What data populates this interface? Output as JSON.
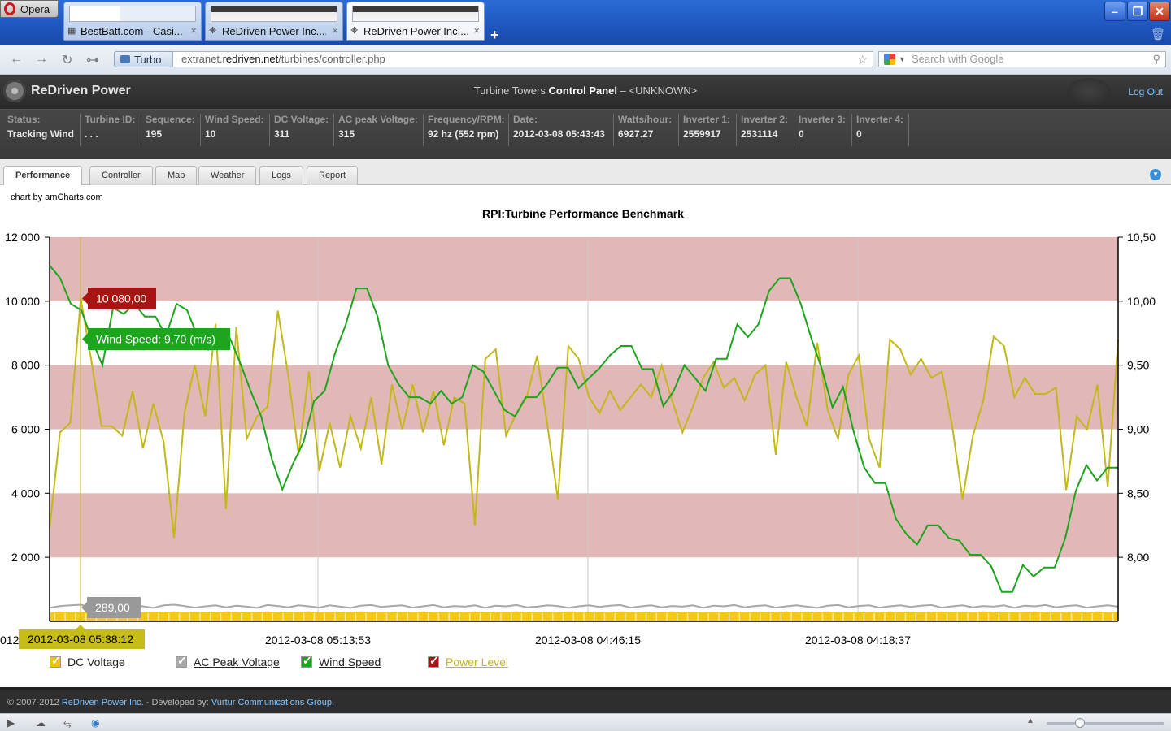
{
  "browser": {
    "menu_label": "Opera",
    "tabs": [
      {
        "label": "BestBatt.com - Casi...",
        "close": "×"
      },
      {
        "label": "ReDriven Power Inc....",
        "close": "×"
      },
      {
        "label": "ReDriven Power Inc....",
        "close": "×"
      }
    ],
    "new_tab": "+",
    "turbo_label": "Turbo",
    "url_prefix": "extranet.",
    "url_domain": "redriven.net",
    "url_path": "/turbines/controller.php",
    "search_placeholder": "Search with Google"
  },
  "app": {
    "logo_text": "ReDriven Power",
    "title_prefix": "Turbine Towers",
    "title_strong": "Control Panel",
    "title_suffix": "– <UNKNOWN>",
    "logout": "Log Out"
  },
  "status": [
    {
      "label": "Status:",
      "value": "Tracking Wind"
    },
    {
      "label": "Turbine ID:",
      "value": ". . ."
    },
    {
      "label": "Sequence:",
      "value": "195"
    },
    {
      "label": "Wind Speed:",
      "value": "10"
    },
    {
      "label": "DC Voltage:",
      "value": "311"
    },
    {
      "label": "AC peak Voltage:",
      "value": "315"
    },
    {
      "label": "Frequency/RPM:",
      "value": "92 hz (552 rpm)"
    },
    {
      "label": "Date:",
      "value": "2012-03-08 05:43:43"
    },
    {
      "label": "Watts/hour:",
      "value": "6927.27"
    },
    {
      "label": "Inverter 1:",
      "value": "2559917"
    },
    {
      "label": "Inverter 2:",
      "value": "2531114"
    },
    {
      "label": "Inverter 3:",
      "value": "0"
    },
    {
      "label": "Inverter 4:",
      "value": "0"
    }
  ],
  "nav_tabs": [
    "Performance",
    "Controller",
    "Map",
    "Weather",
    "Logs",
    "Report"
  ],
  "chart_credit": "chart by amCharts.com",
  "footer": {
    "copyright": "© 2007-2012",
    "company": "ReDriven Power Inc.",
    "dev_text": " - Developed by: ",
    "developer": "Vurtur Communications Group."
  },
  "chart_data": {
    "type": "line",
    "title": "RPI:Turbine Performance Benchmark",
    "left_axis": {
      "min": 0,
      "max": 12000,
      "ticks": [
        "12 000",
        "10 000",
        "8 000",
        "6 000",
        "4 000",
        "2 000"
      ]
    },
    "right_axis": {
      "min": 7.5,
      "max": 10.5,
      "ticks": [
        "10,50",
        "10,00",
        "9,50",
        "9,00",
        "8,50",
        "8,00"
      ]
    },
    "x_labels": [
      "2012-03-08 05:13:53",
      "2012-03-08 04:46:15",
      "2012-03-08 04:18:37"
    ],
    "x_label_clipped": "012",
    "bands": [
      [
        10000,
        12000
      ],
      [
        6000,
        8000
      ],
      [
        2000,
        4000
      ]
    ],
    "colors": {
      "power": "#c2b81a",
      "wind": "#1da51d",
      "dc": "#f2c200",
      "ac": "#a8a8a8",
      "band": "#e2b7b7",
      "balloon_red": "#a81313",
      "balloon_green": "#1ea51e",
      "balloon_gray": "#999999",
      "date_bg": "#c7bd17"
    },
    "cursor": {
      "date": "2012-03-08 05:38:12",
      "power_balloon": "10 080,00",
      "wind_balloon": "Wind Speed: 9,70 (m/s)",
      "voltage_balloon": "289,00"
    },
    "series": [
      {
        "name": "Power Level",
        "axis": "left",
        "values": [
          2900,
          5900,
          6200,
          10080,
          8200,
          6100,
          6100,
          5800,
          7200,
          5400,
          6800,
          5600,
          2600,
          6500,
          8000,
          6400,
          9300,
          3500,
          9200,
          5700,
          6400,
          6700,
          9700,
          7700,
          5200,
          7800,
          4700,
          6200,
          4800,
          6400,
          5400,
          7000,
          4900,
          7400,
          6000,
          7400,
          5900,
          7200,
          5500,
          7000,
          6800,
          3000,
          8200,
          8500,
          5800,
          6500,
          7000,
          8300,
          6100,
          3800,
          8600,
          8200,
          7000,
          6500,
          7200,
          6600,
          7000,
          7400,
          7000,
          8000,
          6900,
          5900,
          6700,
          7600,
          8100,
          7300,
          7600,
          6900,
          7700,
          8000,
          5200,
          8100,
          7000,
          6100,
          8700,
          6600,
          5700,
          7700,
          8300,
          5700,
          4800,
          8800,
          8500,
          7700,
          8200,
          7600,
          7800,
          6100,
          3800,
          5800,
          6900,
          8900,
          8600,
          7000,
          7600,
          7100,
          7100,
          7300,
          4100,
          6400,
          6000,
          7400,
          4200,
          8800
        ]
      },
      {
        "name": "Wind Speed",
        "axis": "right",
        "values": [
          10.28,
          10.18,
          9.98,
          9.93,
          9.7,
          9.5,
          9.95,
          9.9,
          9.98,
          9.88,
          9.88,
          9.73,
          9.98,
          9.93,
          9.72,
          9.62,
          9.68,
          9.72,
          9.52,
          9.3,
          9.1,
          8.77,
          8.53,
          8.73,
          8.9,
          9.22,
          9.3,
          9.6,
          9.82,
          10.1,
          10.1,
          9.88,
          9.5,
          9.35,
          9.25,
          9.25,
          9.2,
          9.3,
          9.2,
          9.25,
          9.5,
          9.45,
          9.3,
          9.15,
          9.1,
          9.25,
          9.25,
          9.35,
          9.48,
          9.48,
          9.32,
          9.4,
          9.48,
          9.58,
          9.65,
          9.65,
          9.47,
          9.47,
          9.18,
          9.3,
          9.5,
          9.4,
          9.3,
          9.55,
          9.55,
          9.82,
          9.72,
          9.82,
          10.08,
          10.18,
          10.18,
          9.98,
          9.71,
          9.47,
          9.17,
          9.33,
          8.98,
          8.7,
          8.58,
          8.58,
          8.3,
          8.18,
          8.1,
          8.25,
          8.25,
          8.15,
          8.13,
          8.02,
          8.02,
          7.93,
          7.73,
          7.73,
          7.94,
          7.85,
          7.92,
          7.92,
          8.15,
          8.52,
          8.72,
          8.6,
          8.7,
          8.7
        ]
      },
      {
        "name": "DC Voltage",
        "axis": "left",
        "values": [
          280,
          310,
          290,
          300,
          320,
          290,
          280,
          300,
          310,
          290,
          300,
          280,
          310,
          290,
          300,
          280,
          290,
          310,
          300,
          280,
          300,
          310,
          290,
          280,
          300,
          310,
          290,
          300,
          280,
          300,
          310,
          290,
          300,
          280,
          300,
          290,
          310,
          280,
          300,
          290,
          300,
          310,
          280,
          290,
          300,
          310,
          290,
          280,
          300,
          290,
          310,
          300,
          280,
          300,
          290,
          310,
          300,
          280,
          290,
          300,
          310,
          280,
          300,
          290,
          300,
          280,
          310,
          290,
          300,
          280,
          300,
          310,
          290,
          280,
          300,
          310,
          290,
          300,
          280,
          300,
          290,
          310,
          300,
          280,
          290,
          300,
          310,
          280,
          300,
          290,
          310,
          300,
          280,
          290,
          300,
          310,
          280,
          300,
          290,
          300,
          280,
          310,
          290,
          300
        ]
      },
      {
        "name": "AC Peak Voltage",
        "axis": "left",
        "values": [
          420,
          480,
          500,
          520,
          430,
          510,
          460,
          440,
          500,
          470,
          420,
          500,
          520,
          480,
          430,
          470,
          500,
          440,
          490,
          460,
          420,
          510,
          480,
          440,
          500,
          470,
          430,
          500,
          460,
          420,
          490,
          510,
          450,
          480,
          500,
          430,
          470,
          510,
          440,
          480,
          460,
          500,
          420,
          490,
          470,
          510,
          440,
          460,
          500,
          480,
          420,
          470,
          500,
          450,
          490,
          510,
          430,
          470,
          500,
          440,
          480,
          460,
          500,
          420,
          490,
          470,
          510,
          440,
          480,
          500,
          430,
          470,
          500,
          460,
          420,
          490,
          510,
          440,
          480,
          500,
          430,
          470,
          500,
          450,
          490,
          510,
          430,
          470,
          500,
          440,
          480,
          460,
          500,
          420,
          490,
          470,
          510,
          440,
          480,
          500,
          430,
          470,
          500,
          460
        ]
      }
    ],
    "legend": [
      {
        "name": "DC Voltage",
        "color": "#f2c200"
      },
      {
        "name": "AC Peak Voltage",
        "color": "#a8a8a8"
      },
      {
        "name": "Wind Speed",
        "color": "#1da51d"
      },
      {
        "name": "Power Level",
        "color": "#a81313"
      }
    ]
  }
}
